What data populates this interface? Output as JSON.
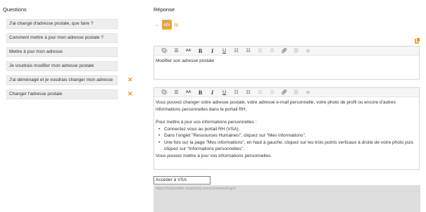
{
  "questions_title": "Questions",
  "reponse_title": "Réponse",
  "questions": [
    {
      "label": "J'ai changé d'adresse postale, que faire ?"
    },
    {
      "label": "Comment mettre à jour mon adresse postale ?"
    },
    {
      "label": "Mettre à jour mon adresse"
    },
    {
      "label": "Je voudrais modifier mon adresse postale"
    },
    {
      "label": "J'ai déménagé et je voudrais changer mon adresse"
    },
    {
      "label": "Changer l'adresse postale"
    }
  ],
  "format_toggle": {
    "code_label": "</>"
  },
  "toolbar_icons": [
    "palette-icon",
    "align-icon",
    "font-size-icon",
    "bold-icon",
    "italic-icon",
    "underline-icon",
    "bullet-list-icon",
    "numbered-list-icon",
    "outdent-icon",
    "indent-icon",
    "link-icon",
    "unlink-icon",
    "emoji-icon"
  ],
  "title_editor": {
    "text": "Modifier son adresse postale"
  },
  "answer_editor": {
    "paragraph1": "Vous pouvez changer votre adresse postale, votre adresse e-mail personnelle, votre photo de profil ou encore d'autres informations personnelles dans le portail RH.",
    "paragraph2": "Pour mettre à jour vos informations personnelles :",
    "bullets": [
      "Connectez vous au portail RH (VSA).",
      "Dans l'onglet \"Ressources Humaines\", cliquez sur \"Mes informations\".",
      "Une fois sur la page \"Mes informations\", en haut à gauche, cliquez sur les trois points verticaux à droite de votre photo puis cliquez sur \"Informations personnelles\"."
    ],
    "paragraph3": "Vous pouvez mettre à jour vos informations personnelles."
  },
  "link": {
    "label": "Accéder à VSA",
    "url": "https://hubsoflab.visactivity.com/common/login/"
  },
  "accent_color": "#e09a1f"
}
